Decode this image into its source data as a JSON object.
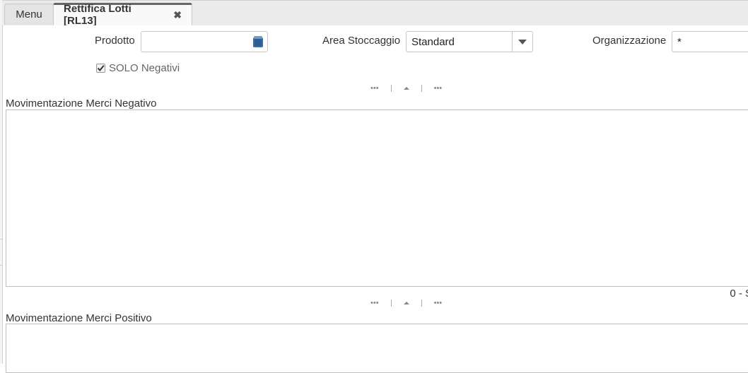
{
  "tabs": {
    "menu_label": "Menu",
    "active_label": "Rettifica Lotti [RL13]",
    "close_glyph": "✖"
  },
  "form": {
    "prodotto_label": "Prodotto",
    "prodotto_value": "",
    "area_label": "Area Stoccaggio",
    "area_value": "Standard",
    "org_label": "Organizzazione",
    "org_value": "*",
    "solo_negativi_label": "SOLO Negativi",
    "solo_negativi_checked": true
  },
  "sections": {
    "negativo_title": "Movimentazione Merci Negativo",
    "negativo_status": "0 - S",
    "positivo_title": "Movimentazione Merci Positivo"
  },
  "splitter": {
    "dots": "•••"
  },
  "icons": {
    "lookup": "lookup-icon",
    "dropdown": "chevron-down-icon",
    "close": "close-icon",
    "collapse": "collapse-up-icon"
  },
  "colors": {
    "lookup_icon": "#3d6fa3",
    "active_tab_top": "#666666"
  }
}
